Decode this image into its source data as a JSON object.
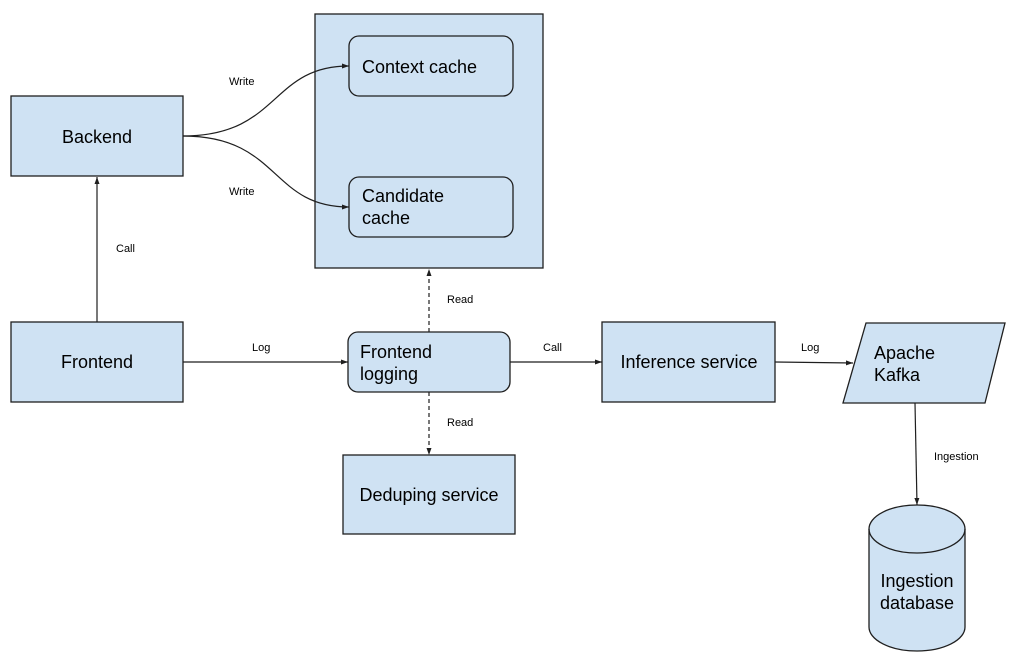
{
  "diagram": {
    "colors": {
      "node_fill": "#cfe2f3",
      "stroke": "#1f1f1f",
      "background": "#ffffff"
    },
    "nodes": {
      "backend": {
        "label": "Backend"
      },
      "frontend": {
        "label": "Frontend"
      },
      "cache_group": {
        "label": ""
      },
      "context_cache": {
        "label": "Context cache"
      },
      "candidate_cache": {
        "label_line1": "Candidate",
        "label_line2": "cache"
      },
      "frontend_logging": {
        "label_line1": "Frontend",
        "label_line2": "logging"
      },
      "deduping_service": {
        "label": "Deduping service"
      },
      "inference_service": {
        "label": "Inference service"
      },
      "apache_kafka": {
        "label_line1": "Apache",
        "label_line2": "Kafka"
      },
      "ingestion_database": {
        "label_line1": "Ingestion",
        "label_line2": "database"
      }
    },
    "edges": {
      "backend_to_context_cache": {
        "label": "Write",
        "style": "solid"
      },
      "backend_to_candidate_cache": {
        "label": "Write",
        "style": "solid"
      },
      "frontend_to_backend": {
        "label": "Call",
        "style": "solid"
      },
      "frontend_to_frontend_logging": {
        "label": "Log",
        "style": "solid"
      },
      "frontend_logging_to_cache_group": {
        "label": "Read",
        "style": "dashed"
      },
      "frontend_logging_to_deduping": {
        "label": "Read",
        "style": "dashed"
      },
      "frontend_logging_to_inference": {
        "label": "Call",
        "style": "solid"
      },
      "inference_to_kafka": {
        "label": "Log",
        "style": "solid"
      },
      "kafka_to_ingestion_db": {
        "label": "Ingestion",
        "style": "solid"
      }
    }
  }
}
